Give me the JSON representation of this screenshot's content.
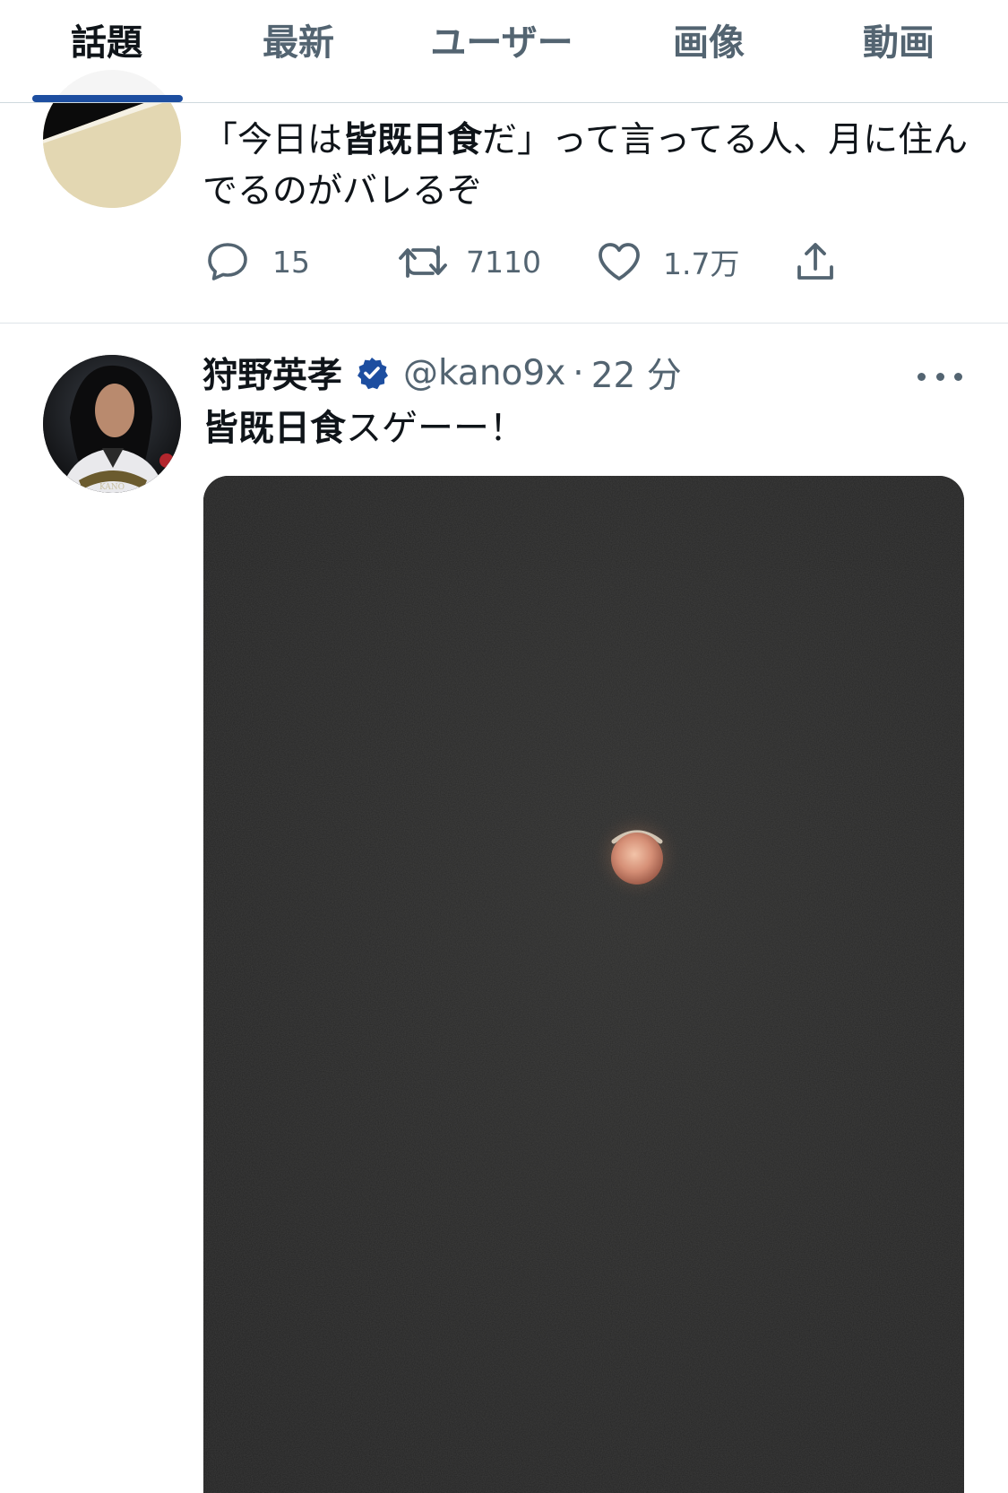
{
  "tabs": [
    {
      "label": "話題",
      "active": true
    },
    {
      "label": "最新",
      "active": false
    },
    {
      "label": "ユーザー",
      "active": false
    },
    {
      "label": "画像",
      "active": false
    },
    {
      "label": "動画",
      "active": false
    }
  ],
  "colors": {
    "accent_underline": "#1d4ea0",
    "verified_badge": "#1d4ea0",
    "secondary_text": "#536471",
    "primary_text": "#0f1419"
  },
  "tweet1": {
    "text_prefix": "「今日は",
    "text_highlight": "皆既日食",
    "text_suffix": "だ」って言ってる人、月に住んでるのがバレるぞ",
    "actions": {
      "reply_count": "15",
      "retweet_count": "7110",
      "like_count": "1.7万",
      "reply_icon": "reply-icon",
      "retweet_icon": "retweet-icon",
      "like_icon": "heart-icon",
      "share_icon": "share-icon"
    }
  },
  "tweet2": {
    "display_name": "狩野英孝",
    "verified": true,
    "handle": "@kano9x",
    "separator": "·",
    "time": "22 分",
    "text_highlight": "皆既日食",
    "text_suffix": "スゲーー！",
    "media_subject": "eclipsed red moon in dark night sky",
    "avatar_caption": "KANO"
  }
}
